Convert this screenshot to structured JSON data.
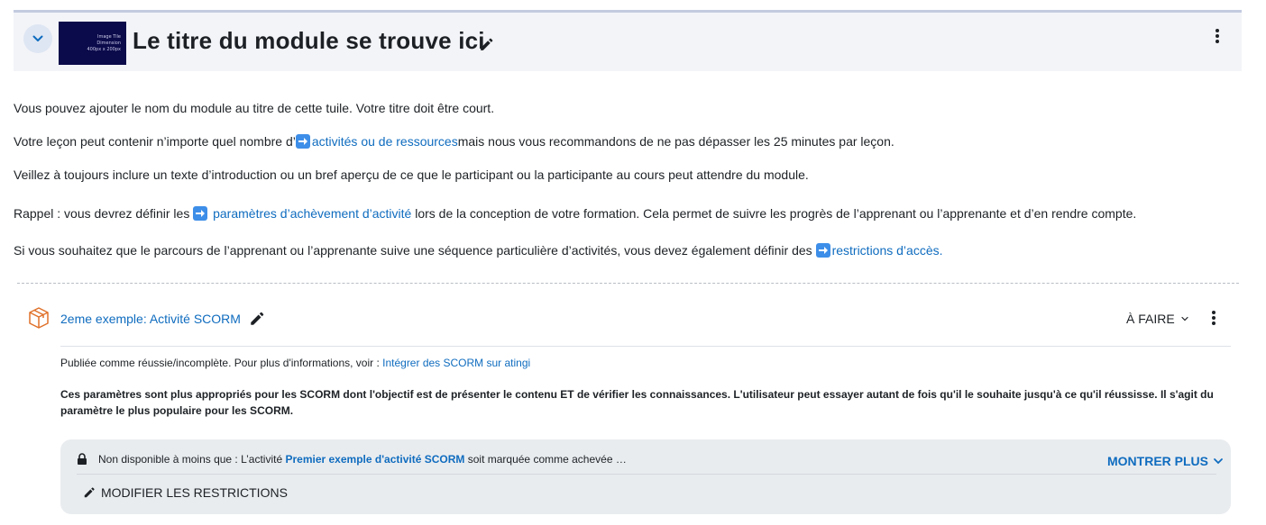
{
  "section": {
    "title": "Le titre du module se trouve ici",
    "thumbnail_lines": [
      "Image Tile",
      "Dimension",
      "400px x 200px"
    ]
  },
  "summary": {
    "p1": "Vous pouvez ajouter le nom du module au titre de cette tuile. Votre titre doit être court.",
    "p2_before": "Votre leçon peut contenir n’importe quel nombre d’",
    "p2_link": "activités ou de ressources",
    "p2_after": "mais nous vous recommandons de ne pas dépasser les 25 minutes par leçon.",
    "p3": "Veillez à toujours inclure un texte d’introduction ou un bref aperçu de ce que le participant ou la participante au cours peut attendre du module.",
    "p4_before": "Rappel : vous devrez définir les ",
    "p4_link": "paramètres d’achèvement d’activité",
    "p4_after": " lors de la conception de votre formation. Cela permet de suivre les progrès de l’apprenant ou l’apprenante et d’en rendre compte.",
    "p5_before": "Si vous souhaitez que le parcours de l’apprenant ou l’apprenante suive une séquence particulière d’activités, vous devez également définir des ",
    "p5_link": "restrictions d’accès."
  },
  "activity": {
    "name": "2eme exemple: Activité SCORM",
    "status": "À FAIRE",
    "info_prefix": "Publiée comme réussie/incomplète. Pour plus d'informations, voir : ",
    "info_link": "Intégrer des SCORM sur atingi",
    "description": "Ces paramètres sont plus appropriés pour les SCORM dont l'objectif est de présenter le contenu ET de vérifier les connaissances. L'utilisateur peut essayer autant de fois qu'il le souhaite jusqu'à ce qu'il réussisse. Il s'agit du paramètre le plus populaire pour les SCORM."
  },
  "restriction": {
    "prefix": "Non disponible à moins que : L’activité ",
    "link": "Premier exemple d'activité SCORM",
    "suffix": " soit marquée comme achevée …",
    "show_more": "MONTRER PLUS",
    "edit": "MODIFIER LES RESTRICTIONS"
  },
  "colors": {
    "link": "#0f6cbf",
    "header_bg": "#f3f4f8",
    "restriction_bg": "#e9ecef",
    "activity_icon": "#e0712a"
  },
  "icons": [
    "chevron-down-icon",
    "pencil-icon",
    "kebab-menu-icon",
    "arrow-right-emoji-icon",
    "package-icon",
    "lock-icon"
  ]
}
